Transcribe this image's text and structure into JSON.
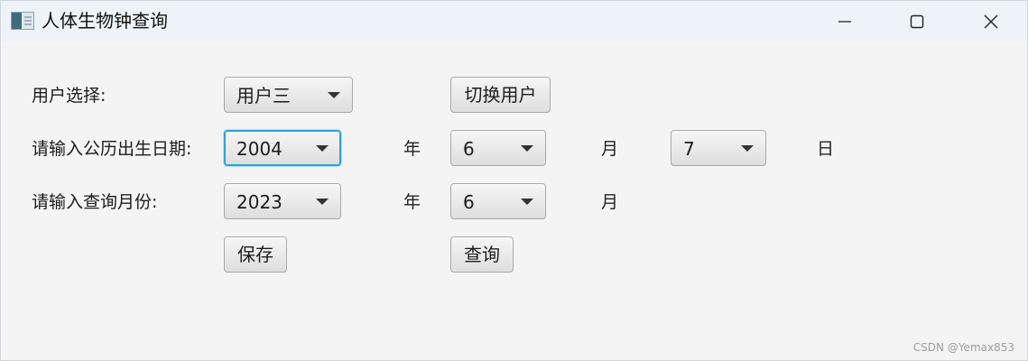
{
  "window": {
    "title": "人体生物钟查询",
    "icon": "app-window-icon",
    "controls": [
      "minimize-icon",
      "maximize-icon",
      "close-icon"
    ]
  },
  "form": {
    "user_row": {
      "label": "用户选择:",
      "selected_user": "用户三",
      "switch_button": "切换用户"
    },
    "birth_row": {
      "label": "请输入公历出生日期:",
      "year": "2004",
      "year_unit": "年",
      "month": "6",
      "month_unit": "月",
      "day": "7",
      "day_unit": "日"
    },
    "query_row": {
      "label": "请输入查询月份:",
      "year": "2023",
      "year_unit": "年",
      "month": "6",
      "month_unit": "月"
    },
    "actions": {
      "save_button": "保存",
      "query_button": "查询"
    }
  },
  "watermark": "CSDN @Yemax853",
  "colors": {
    "background": "#f4f4f4",
    "titlebar": "#eef3f7",
    "focus_ring": "#2fa0dc"
  }
}
